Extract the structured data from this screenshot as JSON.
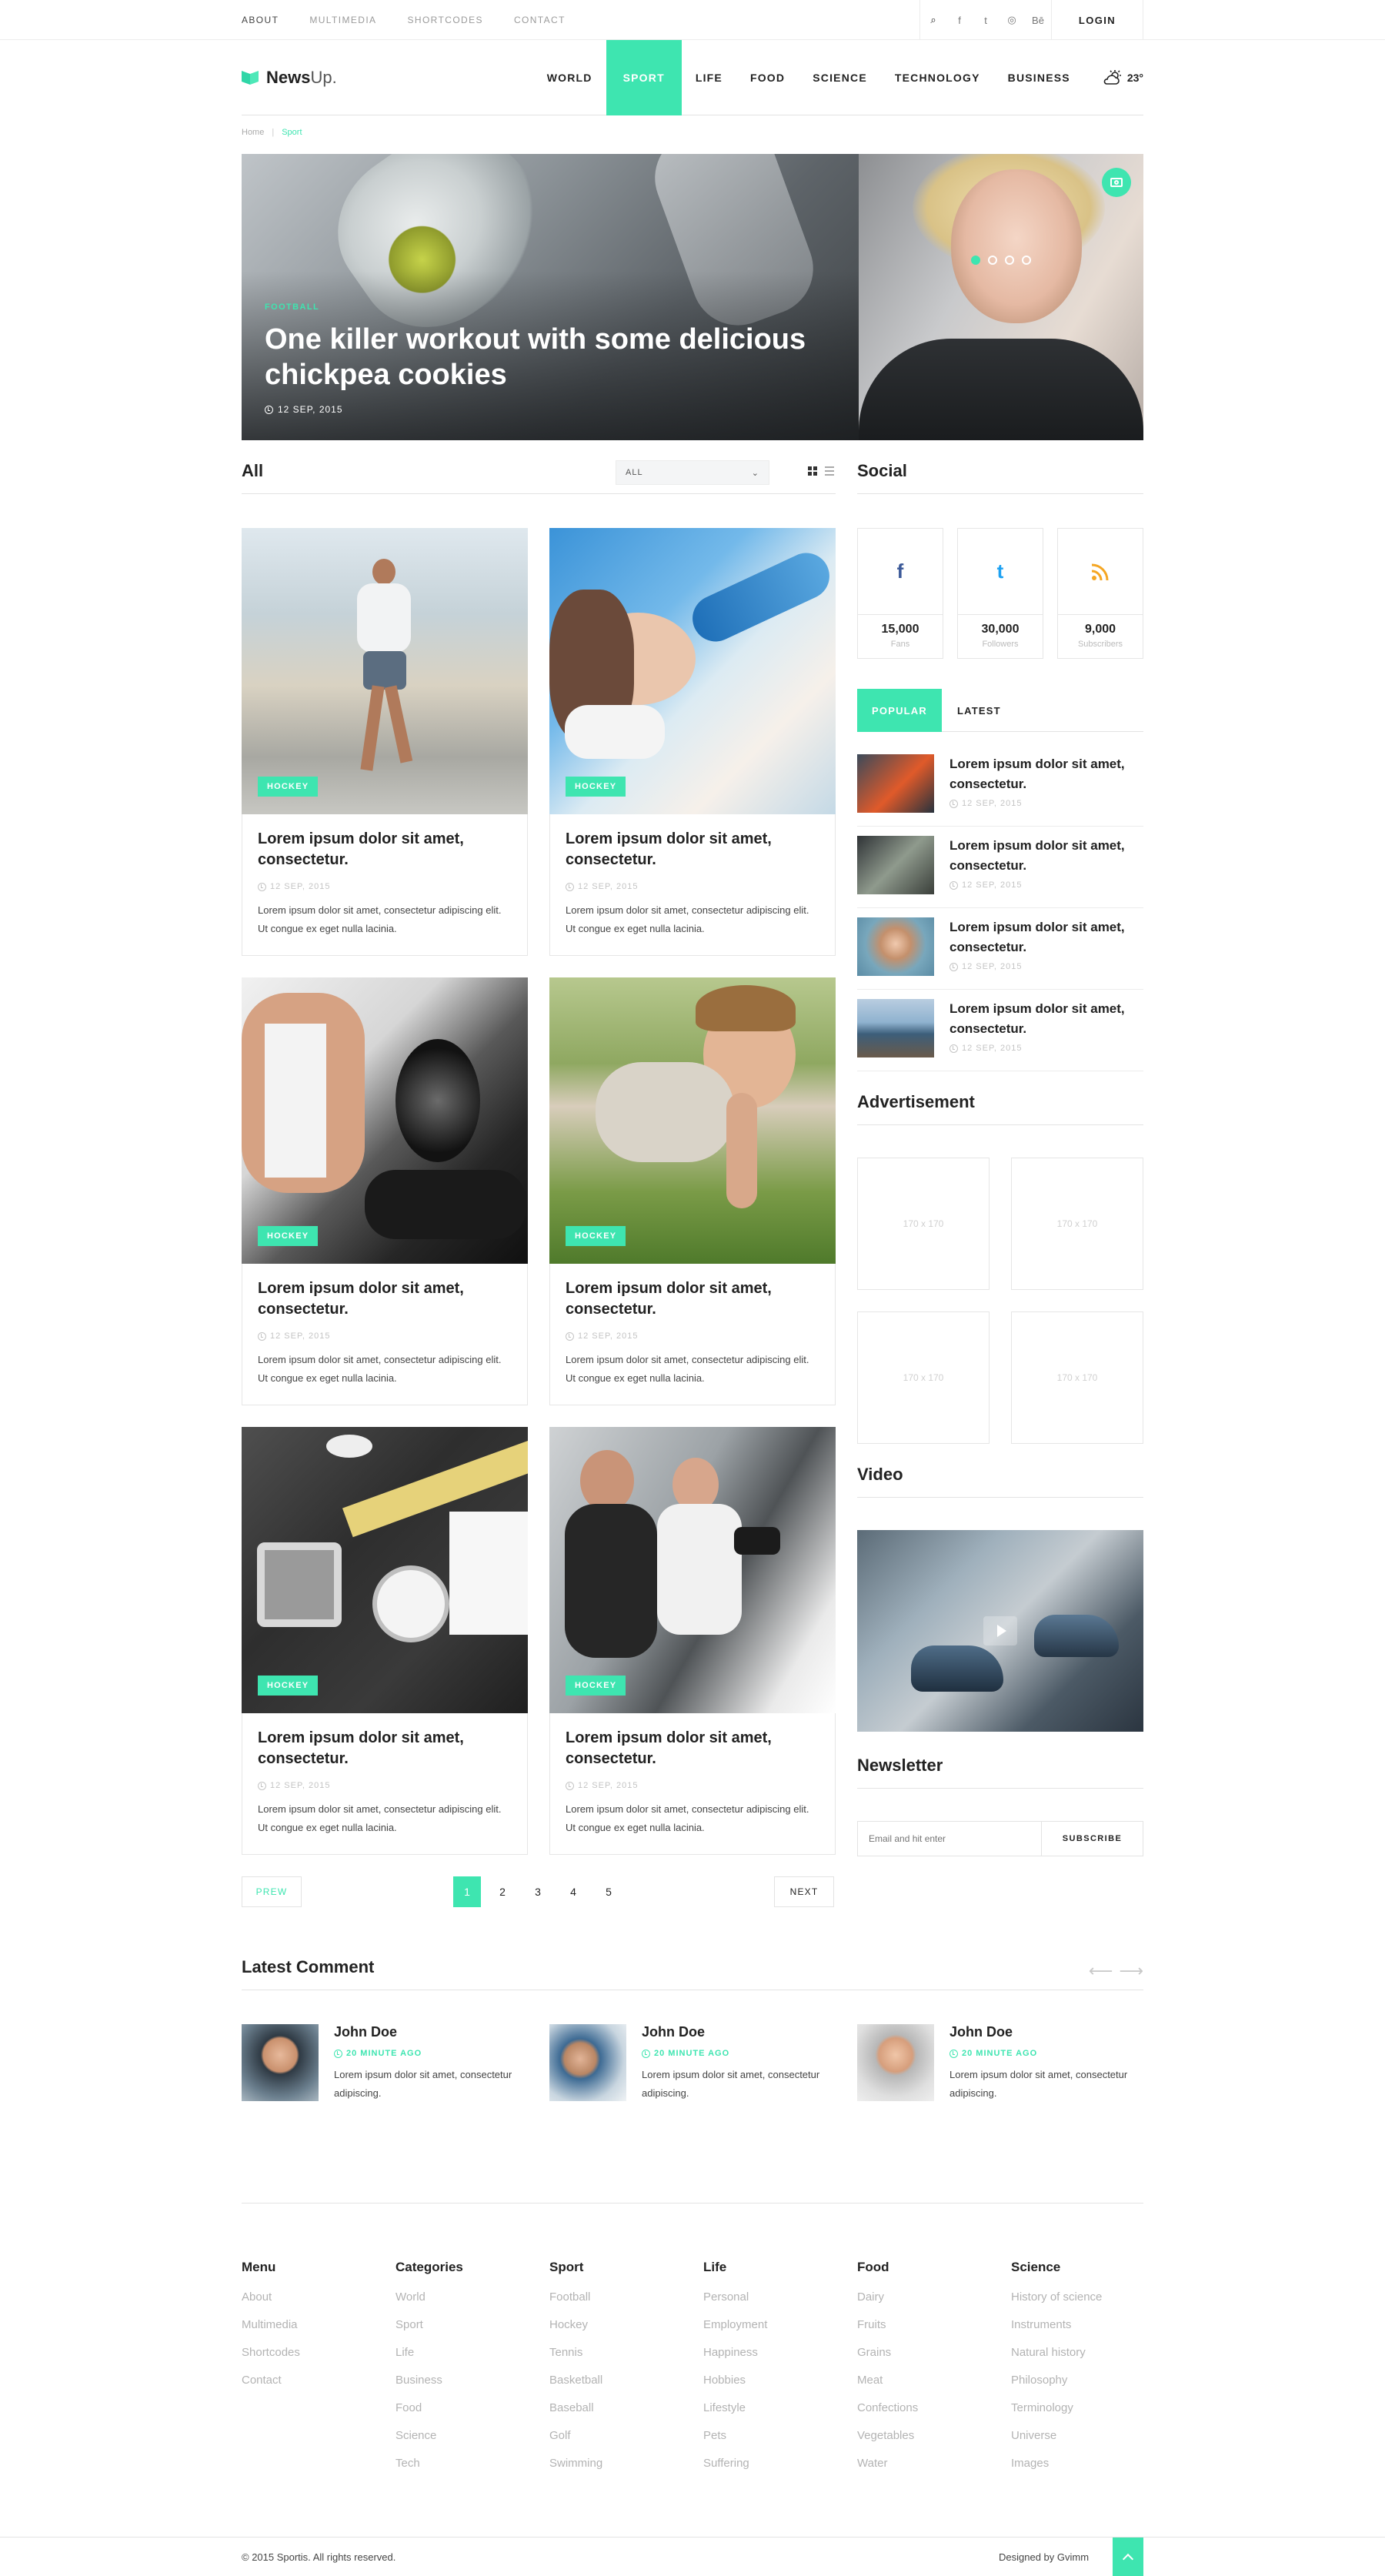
{
  "topbar": {
    "links": [
      "ABOUT",
      "MULTIMEDIA",
      "SHORTCODES",
      "CONTACT"
    ],
    "social_icons": [
      {
        "icon": "search-icon",
        "glyph": "⌕"
      },
      {
        "icon": "facebook-icon",
        "glyph": "f"
      },
      {
        "icon": "twitter-icon",
        "glyph": "t"
      },
      {
        "icon": "dribbble-icon",
        "glyph": "◎"
      },
      {
        "icon": "behance-icon",
        "glyph": "Bē"
      }
    ],
    "login_label": "LOGIN"
  },
  "header": {
    "logo_bold": "News",
    "logo_light": "Up.",
    "nav": [
      "WORLD",
      "SPORT",
      "LIFE",
      "FOOD",
      "SCIENCE",
      "TECHNOLOGY",
      "BUSINESS"
    ],
    "active_nav": "SPORT",
    "weather_icon": "cloud-sun-icon",
    "temperature": "23°"
  },
  "breadcrumb": {
    "home": "Home",
    "separator": "|",
    "current": "Sport"
  },
  "hero": {
    "category": "FOOTBALL",
    "title": "One killer workout with some delicious chickpea cookies",
    "date": "12 SEP, 2015",
    "slides": 4,
    "active_slide": 1
  },
  "all_section": {
    "title": "All",
    "filter_value": "ALL"
  },
  "cards": [
    {
      "tag": "HOCKEY",
      "title": "Lorem ipsum dolor sit amet, consectetur.",
      "date": "12 SEP, 2015",
      "text": "Lorem ipsum dolor sit amet, consectetur adipiscing elit. Ut congue ex eget nulla lacinia."
    },
    {
      "tag": "HOCKEY",
      "title": "Lorem ipsum dolor sit amet, consectetur.",
      "date": "12 SEP, 2015",
      "text": "Lorem ipsum dolor sit amet, consectetur adipiscing elit. Ut congue ex eget nulla lacinia."
    },
    {
      "tag": "HOCKEY",
      "title": "Lorem ipsum dolor sit amet, consectetur.",
      "date": "12 SEP, 2015",
      "text": "Lorem ipsum dolor sit amet, consectetur adipiscing elit. Ut congue ex eget nulla lacinia."
    },
    {
      "tag": "HOCKEY",
      "title": "Lorem ipsum dolor sit amet, consectetur.",
      "date": "12 SEP, 2015",
      "text": "Lorem ipsum dolor sit amet, consectetur adipiscing elit. Ut congue ex eget nulla lacinia."
    },
    {
      "tag": "HOCKEY",
      "title": "Lorem ipsum dolor sit amet, consectetur.",
      "date": "12 SEP, 2015",
      "text": "Lorem ipsum dolor sit amet, consectetur adipiscing elit. Ut congue ex eget nulla lacinia."
    },
    {
      "tag": "HOCKEY",
      "title": "Lorem ipsum dolor sit amet, consectetur.",
      "date": "12 SEP, 2015",
      "text": "Lorem ipsum dolor sit amet, consectetur adipiscing elit. Ut congue ex eget nulla lacinia."
    }
  ],
  "pagination": {
    "prev": "PREW",
    "next": "NEXT",
    "pages": [
      "1",
      "2",
      "3",
      "4",
      "5"
    ],
    "current": "1"
  },
  "sidebar": {
    "social_title": "Social",
    "social": [
      {
        "icon": "facebook-icon",
        "glyph": "f",
        "count": "15,000",
        "label": "Fans",
        "color": "#3b5998"
      },
      {
        "icon": "twitter-icon",
        "glyph": "t",
        "count": "30,000",
        "label": "Followers",
        "color": "#1da1f2"
      },
      {
        "icon": "rss-icon",
        "glyph": "◝",
        "count": "9,000",
        "label": "Subscribers",
        "color": "#f5a623"
      }
    ],
    "tabs": [
      "POPULAR",
      "LATEST"
    ],
    "popular": [
      {
        "title": "Lorem ipsum dolor sit amet, consectetur.",
        "date": "12 SEP, 2015"
      },
      {
        "title": "Lorem ipsum dolor sit amet, consectetur.",
        "date": "12 SEP, 2015"
      },
      {
        "title": "Lorem ipsum dolor sit amet, consectetur.",
        "date": "12 SEP, 2015"
      },
      {
        "title": "Lorem ipsum dolor sit amet, consectetur.",
        "date": "12 SEP, 2015"
      }
    ],
    "ad_title": "Advertisement",
    "ads": [
      "170 x 170",
      "170 x 170",
      "170 x 170",
      "170 x 170"
    ],
    "video_title": "Video",
    "newsletter_title": "Newsletter",
    "newsletter_placeholder": "Email and hit enter",
    "subscribe_label": "SUBSCRIBE"
  },
  "latest_comment": {
    "title": "Latest Comment",
    "prev_arrow": "⟵",
    "next_arrow": "⟶",
    "items": [
      {
        "name": "John Doe",
        "time": "20 MINUTE AGO",
        "text": "Lorem ipsum dolor sit amet, consectetur adipiscing."
      },
      {
        "name": "John Doe",
        "time": "20 MINUTE AGO",
        "text": "Lorem ipsum dolor sit amet, consectetur adipiscing."
      },
      {
        "name": "John Doe",
        "time": "20 MINUTE AGO",
        "text": "Lorem ipsum dolor sit amet, consectetur adipiscing."
      }
    ]
  },
  "footer": {
    "columns": [
      {
        "title": "Menu",
        "items": [
          "About",
          "Multimedia",
          "Shortcodes",
          "Contact"
        ]
      },
      {
        "title": "Categories",
        "items": [
          "World",
          "Sport",
          "Life",
          "Business",
          "Food",
          "Science",
          "Tech"
        ]
      },
      {
        "title": "Sport",
        "items": [
          "Football",
          "Hockey",
          "Tennis",
          "Basketball",
          "Baseball",
          "Golf",
          "Swimming"
        ]
      },
      {
        "title": "Life",
        "items": [
          "Personal",
          "Employment",
          "Happiness",
          "Hobbies",
          "Lifestyle",
          "Pets",
          "Suffering"
        ]
      },
      {
        "title": "Food",
        "items": [
          "Dairy",
          "Fruits",
          "Grains",
          "Meat",
          "Confections",
          "Vegetables",
          "Water"
        ]
      },
      {
        "title": "Science",
        "items": [
          "History of science",
          "Instruments",
          "Natural history",
          "Philosophy",
          "Terminology",
          "Universe",
          "Images"
        ]
      }
    ],
    "copyright": "© 2015 Sportis. All rights reserved.",
    "designed_by": "Designed by Gvimm"
  },
  "colors": {
    "accent": "#3ee5b0",
    "text": "#222222",
    "muted": "#b3b3b3"
  }
}
